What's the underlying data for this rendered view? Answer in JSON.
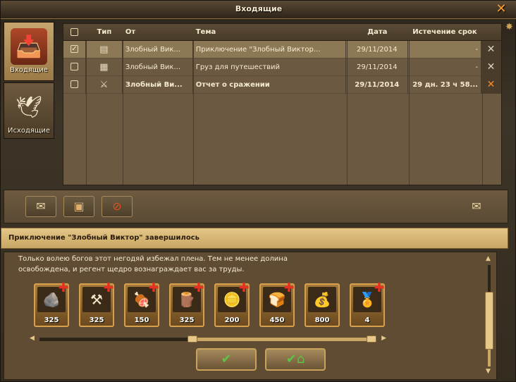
{
  "window": {
    "title": "Входящие",
    "close_icon": "close-icon"
  },
  "tabs": [
    {
      "label": "Входящие",
      "icon": "inbox-chest-icon",
      "active": true
    },
    {
      "label": "Исходящие",
      "icon": "pigeon-icon",
      "active": false
    }
  ],
  "list": {
    "headers": {
      "type": "Тип",
      "from": "От",
      "subject": "Тема",
      "date": "Дата",
      "expires": "Истечение срок"
    },
    "rows": [
      {
        "checked": true,
        "type_icon": "map-scroll-icon",
        "from": "Злобный Вик...",
        "subject": "Приключение \"Злобный Виктор...",
        "date": "29/11/2014",
        "expires": "-",
        "bold": false,
        "selected": true,
        "delete_color": "grey"
      },
      {
        "checked": false,
        "type_icon": "crate-icon",
        "from": "Злобный Вик...",
        "subject": "Груз для путешествий",
        "date": "29/11/2014",
        "expires": "-",
        "bold": false,
        "selected": false,
        "delete_color": "grey"
      },
      {
        "checked": false,
        "type_icon": "crossed-swords-icon",
        "from": "Злобный Ви...",
        "subject": "Отчет о сражении",
        "date": "29/11/2014",
        "expires": "29 дн. 23 ч 58...",
        "bold": true,
        "selected": false,
        "delete_color": "orange"
      }
    ]
  },
  "toolbar": {
    "buttons": [
      "envelope-icon",
      "open-chest-icon",
      "delete-all-icon"
    ],
    "right_button": "envelope-icon"
  },
  "message": {
    "subject": "Приключение \"Злобный Виктор\" завершилось",
    "line1": "Только волею богов этот негодяй избежал плена. Тем не менее долина",
    "line2": "освобождена, и регент щедро вознаграждает вас за труды.",
    "rewards": [
      {
        "amount": "325",
        "icon": "stone-resource-icon"
      },
      {
        "amount": "325",
        "icon": "tools-resource-icon"
      },
      {
        "amount": "150",
        "icon": "meat-resource-icon"
      },
      {
        "amount": "325",
        "icon": "wood-resource-icon"
      },
      {
        "amount": "200",
        "icon": "coins-resource-icon"
      },
      {
        "amount": "450",
        "icon": "bread-resource-icon"
      },
      {
        "amount": "800",
        "icon": "sack-resource-icon"
      },
      {
        "amount": "4",
        "icon": "medal-resource-icon"
      }
    ],
    "buttons": [
      "accept-button",
      "accept-home-button"
    ]
  },
  "colors": {
    "accent": "#d8a04a",
    "selected_row": "#8d7856",
    "delete_active": "#ff8a1e"
  }
}
